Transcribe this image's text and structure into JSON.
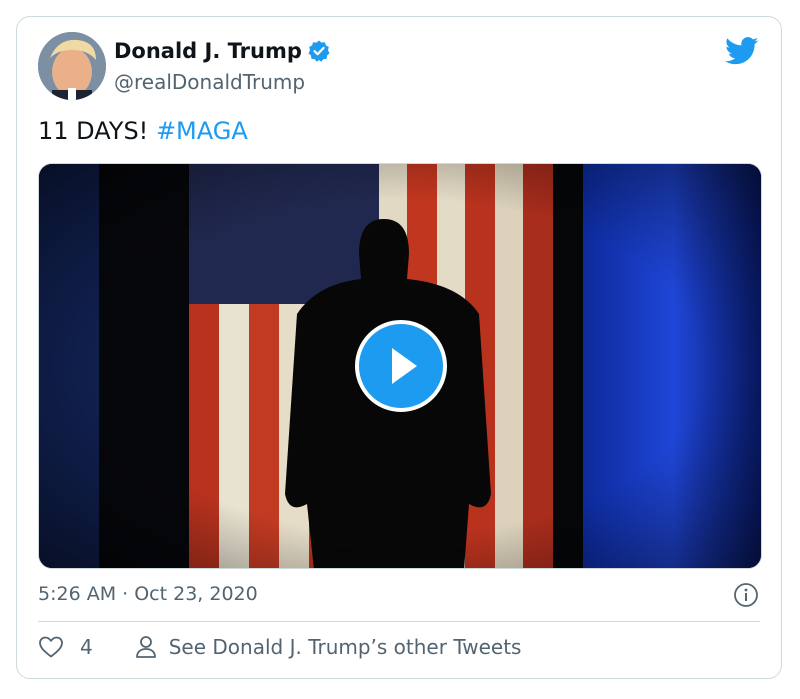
{
  "tweet": {
    "author_name": "Donald J. Trump",
    "author_handle": "@realDonaldTrump",
    "text": "11 DAYS! ",
    "hashtag": "#MAGA",
    "timestamp": "5:26 AM · Oct 23, 2020",
    "like_count": "4",
    "see_other_label": "See Donald J. Trump’s other Tweets"
  },
  "icons": {
    "verified": "verified-badge-icon",
    "brand": "twitter-bird-icon",
    "play": "play-icon",
    "info": "info-icon",
    "like": "heart-icon",
    "person": "person-icon"
  },
  "colors": {
    "accent": "#1d9bf0",
    "text_primary": "#0f1419",
    "text_secondary": "#536471",
    "border": "#cfd9de"
  }
}
